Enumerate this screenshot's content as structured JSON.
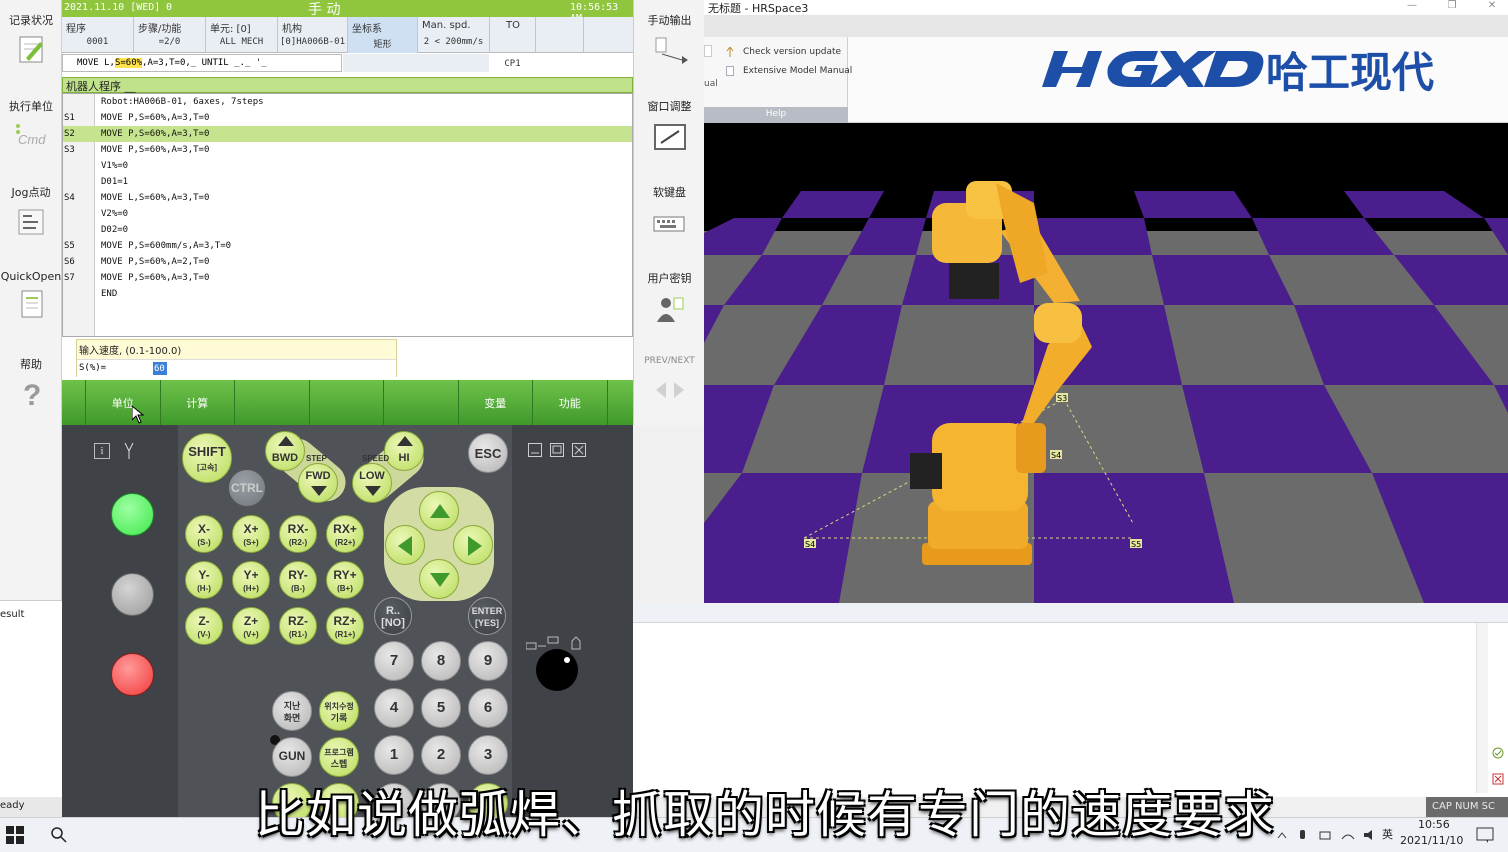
{
  "sidebar": {
    "items": [
      {
        "label": "记录状况",
        "icon": "notepad-icon"
      },
      {
        "label": "执行单位",
        "icon": "cmd-icon"
      },
      {
        "label": "Jog点动",
        "icon": "jog-list-icon"
      },
      {
        "label": "QuickOpen",
        "icon": "document-icon"
      },
      {
        "label": "帮助",
        "icon": "question-icon"
      }
    ]
  },
  "pendant": {
    "status": {
      "date": "2021.11.10 [WED]",
      "signal": "0",
      "mode": "手 动",
      "time": "10:56:53 AM"
    },
    "info": {
      "program_title": "程序",
      "program_value": "0001",
      "step_title": "步骤/功能",
      "step_value": "=2/0",
      "unit_title": "单元: [0]",
      "unit_value": "ALL MECH",
      "mech_title": "机构",
      "mech_value": "[0]HA006B-01",
      "coord_title": "坐标系",
      "coord_value": "矩形",
      "speed_title": "Man. spd.",
      "speed_value": "2 < 200mm/s",
      "tool_title": "TO",
      "tool_value": "CP1"
    },
    "command_line": {
      "prefix": "MOVE L,",
      "highlight": "S=60%",
      "suffix": ",A=3,T=0,_ UNTIL _._ '_"
    },
    "program_header": "机器人程序 __",
    "program_lines": [
      {
        "step": "",
        "text": "Robot:HA006B-01, 6axes, 7steps"
      },
      {
        "step": "S1",
        "text": "MOVE P,S=60%,A=3,T=0"
      },
      {
        "step": "S2",
        "text": "MOVE P,S=60%,A=3,T=0"
      },
      {
        "step": "S3",
        "text": "MOVE P,S=60%,A=3,T=0"
      },
      {
        "step": "",
        "text": "V1%=0"
      },
      {
        "step": "",
        "text": "D01=1"
      },
      {
        "step": "S4",
        "text": "MOVE L,S=60%,A=3,T=0"
      },
      {
        "step": "",
        "text": "V2%=0"
      },
      {
        "step": "",
        "text": "D02=0"
      },
      {
        "step": "S5",
        "text": "MOVE P,S=600mm/s,A=3,T=0"
      },
      {
        "step": "S6",
        "text": "MOVE P,S=60%,A=2,T=0"
      },
      {
        "step": "S7",
        "text": "MOVE P,S=60%,A=3,T=0"
      },
      {
        "step": "",
        "text": "END"
      }
    ],
    "selected_line": 2,
    "input": {
      "label": "输入速度, (0.1-100.0)",
      "prefix": "S(%)=",
      "value": "60"
    },
    "softkeys": [
      "",
      "单位",
      "计算",
      "",
      "",
      "",
      "变量",
      "功能"
    ]
  },
  "pendant_tools": [
    {
      "label": "手动输出",
      "icon": "manual-output-icon"
    },
    {
      "label": "窗口调整",
      "icon": "window-adjust-icon"
    },
    {
      "label": "软键盘",
      "icon": "keyboard-icon"
    },
    {
      "label": "用户密钥",
      "icon": "user-key-icon"
    },
    {
      "label": "PREV/NEXT",
      "icon": "prev-next-icon"
    }
  ],
  "keypad": {
    "shift": "SHIFT",
    "shift_sub": "[고속]",
    "ctrl": "CTRL",
    "bwd": "BWD",
    "step": "STEP",
    "fwd": "FWD",
    "speed": "SPEED",
    "hi": "HI",
    "low": "LOW",
    "esc": "ESC",
    "axis_keys": [
      [
        "X-",
        "(S-)"
      ],
      [
        "X+",
        "(S+)"
      ],
      [
        "RX-",
        "(R2-)"
      ],
      [
        "RX+",
        "(R2+)"
      ],
      [
        "Y-",
        "(H-)"
      ],
      [
        "Y+",
        "(H+)"
      ],
      [
        "RY-",
        "(B-)"
      ],
      [
        "RY+",
        "(B+)"
      ],
      [
        "Z-",
        "(V-)"
      ],
      [
        "Z+",
        "(V+)"
      ],
      [
        "RZ-",
        "(R1-)"
      ],
      [
        "RZ+",
        "(R1+)"
      ]
    ],
    "r_no": [
      "R..",
      "[NO]"
    ],
    "enter_yes": [
      "ENTER",
      "[YES]"
    ],
    "digits": [
      "7",
      "8",
      "9",
      "4",
      "5",
      "6",
      "1",
      "2",
      "3"
    ],
    "prev_screen": [
      "지난",
      "화면"
    ],
    "pos_record": [
      "위치수정",
      "기록"
    ],
    "gun": "GUN",
    "program_step": [
      "프로그램",
      "스텝"
    ],
    "info_icon": "i",
    "lamps": {
      "green": "#3ee84a",
      "grey": "#9a9a9a",
      "red": "#f23838"
    }
  },
  "hrspace": {
    "title": "无标题 - HRSpace3",
    "help_items": [
      "Check version update",
      "Extensive Model Manual"
    ],
    "help_group": "Help",
    "ual": "ual",
    "logo_text": "哈工现代",
    "point_labels": [
      "S4",
      "S3",
      "S5"
    ]
  },
  "left_result": "esult",
  "ready": "eady",
  "status_strip": "CAP  NUM  SC",
  "taskbar": {
    "lang": "英",
    "time": "10:56",
    "date": "2021/11/10"
  },
  "subtitle": "比如说做弧焊、抓取的时候有专门的速度要求"
}
